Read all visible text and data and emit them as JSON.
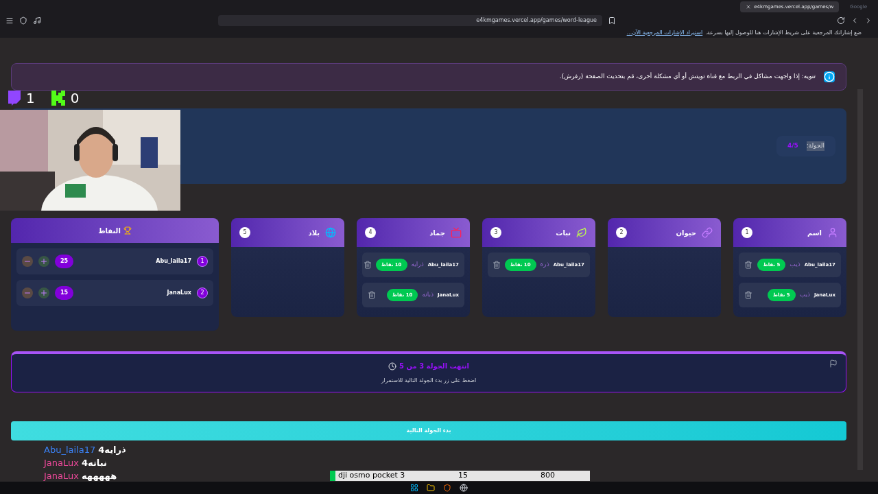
{
  "browser": {
    "tabs": [
      {
        "label": "Google",
        "selected": false
      },
      {
        "label": "e4kmgames.vercel.app/games/w",
        "selected": true
      }
    ],
    "address": "e4kmgames.vercel.app/games/word-league",
    "bookmarks_hint": "ضع إشاراتك المرجعية على شريط الإشارات هنا للوصول إليها بسرعة.",
    "bookmarks_link": "استيراد الإشارات المرجعية الآن..."
  },
  "notice": "تنويه: إذا واجهت مشاكل في الربط مع قناة تويتش أو أي مشكلة أخرى، قم بتحديث الصفحة (رفرش).",
  "round": {
    "label": "الجولة:",
    "value": "4/5"
  },
  "categories": [
    {
      "number": "1",
      "title": "اسم",
      "kind": "person",
      "answers": [
        {
          "player": "Abu_laila17",
          "word": "ذيب",
          "points": "5 نقاط"
        },
        {
          "player": "JanaLux",
          "word": "ذيب",
          "points": "5 نقاط"
        }
      ]
    },
    {
      "number": "2",
      "title": "حيوان",
      "kind": "link"
    },
    {
      "number": "3",
      "title": "نبات",
      "kind": "leaf",
      "answers": [
        {
          "player": "Abu_laila17",
          "word": "ذرة",
          "points": "10 نقاط"
        }
      ]
    },
    {
      "number": "4",
      "title": "جماد",
      "kind": "tv",
      "answers": [
        {
          "player": "Abu_laila17",
          "word": "ذرايه",
          "points": "10 نقاط"
        },
        {
          "player": "JanaLux",
          "word": "ذبانه",
          "points": "10 نقاط"
        }
      ]
    },
    {
      "number": "5",
      "title": "بلاد",
      "kind": "globe"
    }
  ],
  "scores": {
    "title": "النقاط",
    "rows": [
      {
        "rank": "1",
        "player": "Abu_laila17",
        "score": "25"
      },
      {
        "rank": "2",
        "player": "JanaLux",
        "score": "15"
      }
    ]
  },
  "round_end": {
    "title": "انتهت الجولة 3 من 5",
    "subtitle": "اضغط على زر بدء الجولة التالية للاستمرار"
  },
  "next_button": "بدء الجولة التالية",
  "stream": {
    "scores": [
      {
        "kind": "kick",
        "value": "0"
      },
      {
        "kind": "twitch",
        "value": "1"
      }
    ],
    "chat": [
      {
        "user": "Abu_laila17",
        "message": "ذرايه4",
        "color": "#3b82f6"
      },
      {
        "user": "JanaLux",
        "message": "نباته4",
        "color": "#ec4899"
      },
      {
        "user": "JanaLux",
        "message": "هههههه",
        "color": "#ec4899"
      }
    ],
    "ticker": {
      "name": "dji osmo pocket 3",
      "count": "15",
      "goal": "800",
      "level": 0.02
    }
  }
}
